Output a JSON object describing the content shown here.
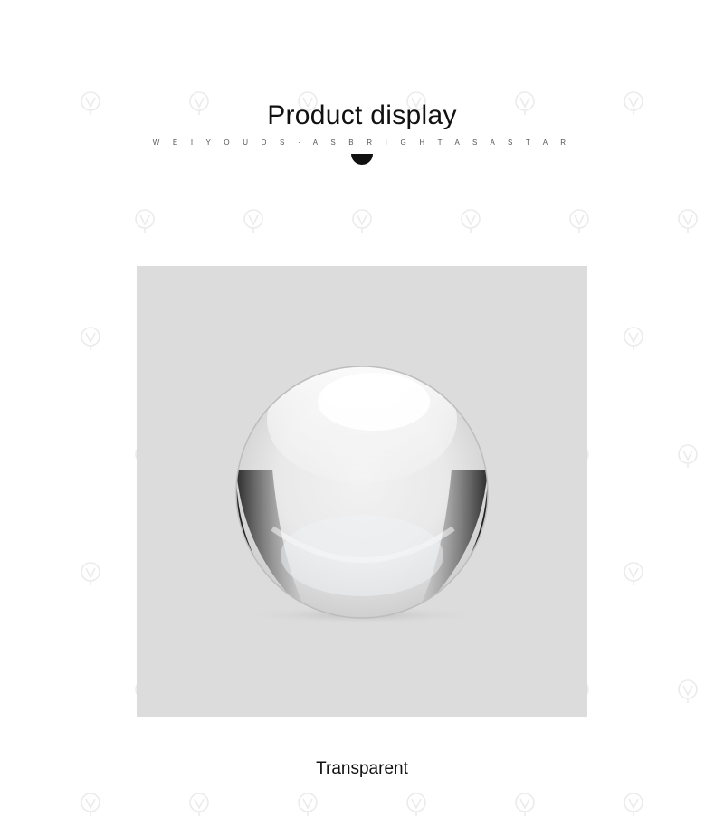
{
  "header": {
    "title": "Product display",
    "subtitle": "W E I Y O U D S · A S B R I G H T A S A S T A R"
  },
  "product": {
    "name": "crystal-ball",
    "caption": "Transparent",
    "frame_color": "#dcdcdc"
  },
  "watermark": {
    "icon": "logo-watermark-icon"
  }
}
